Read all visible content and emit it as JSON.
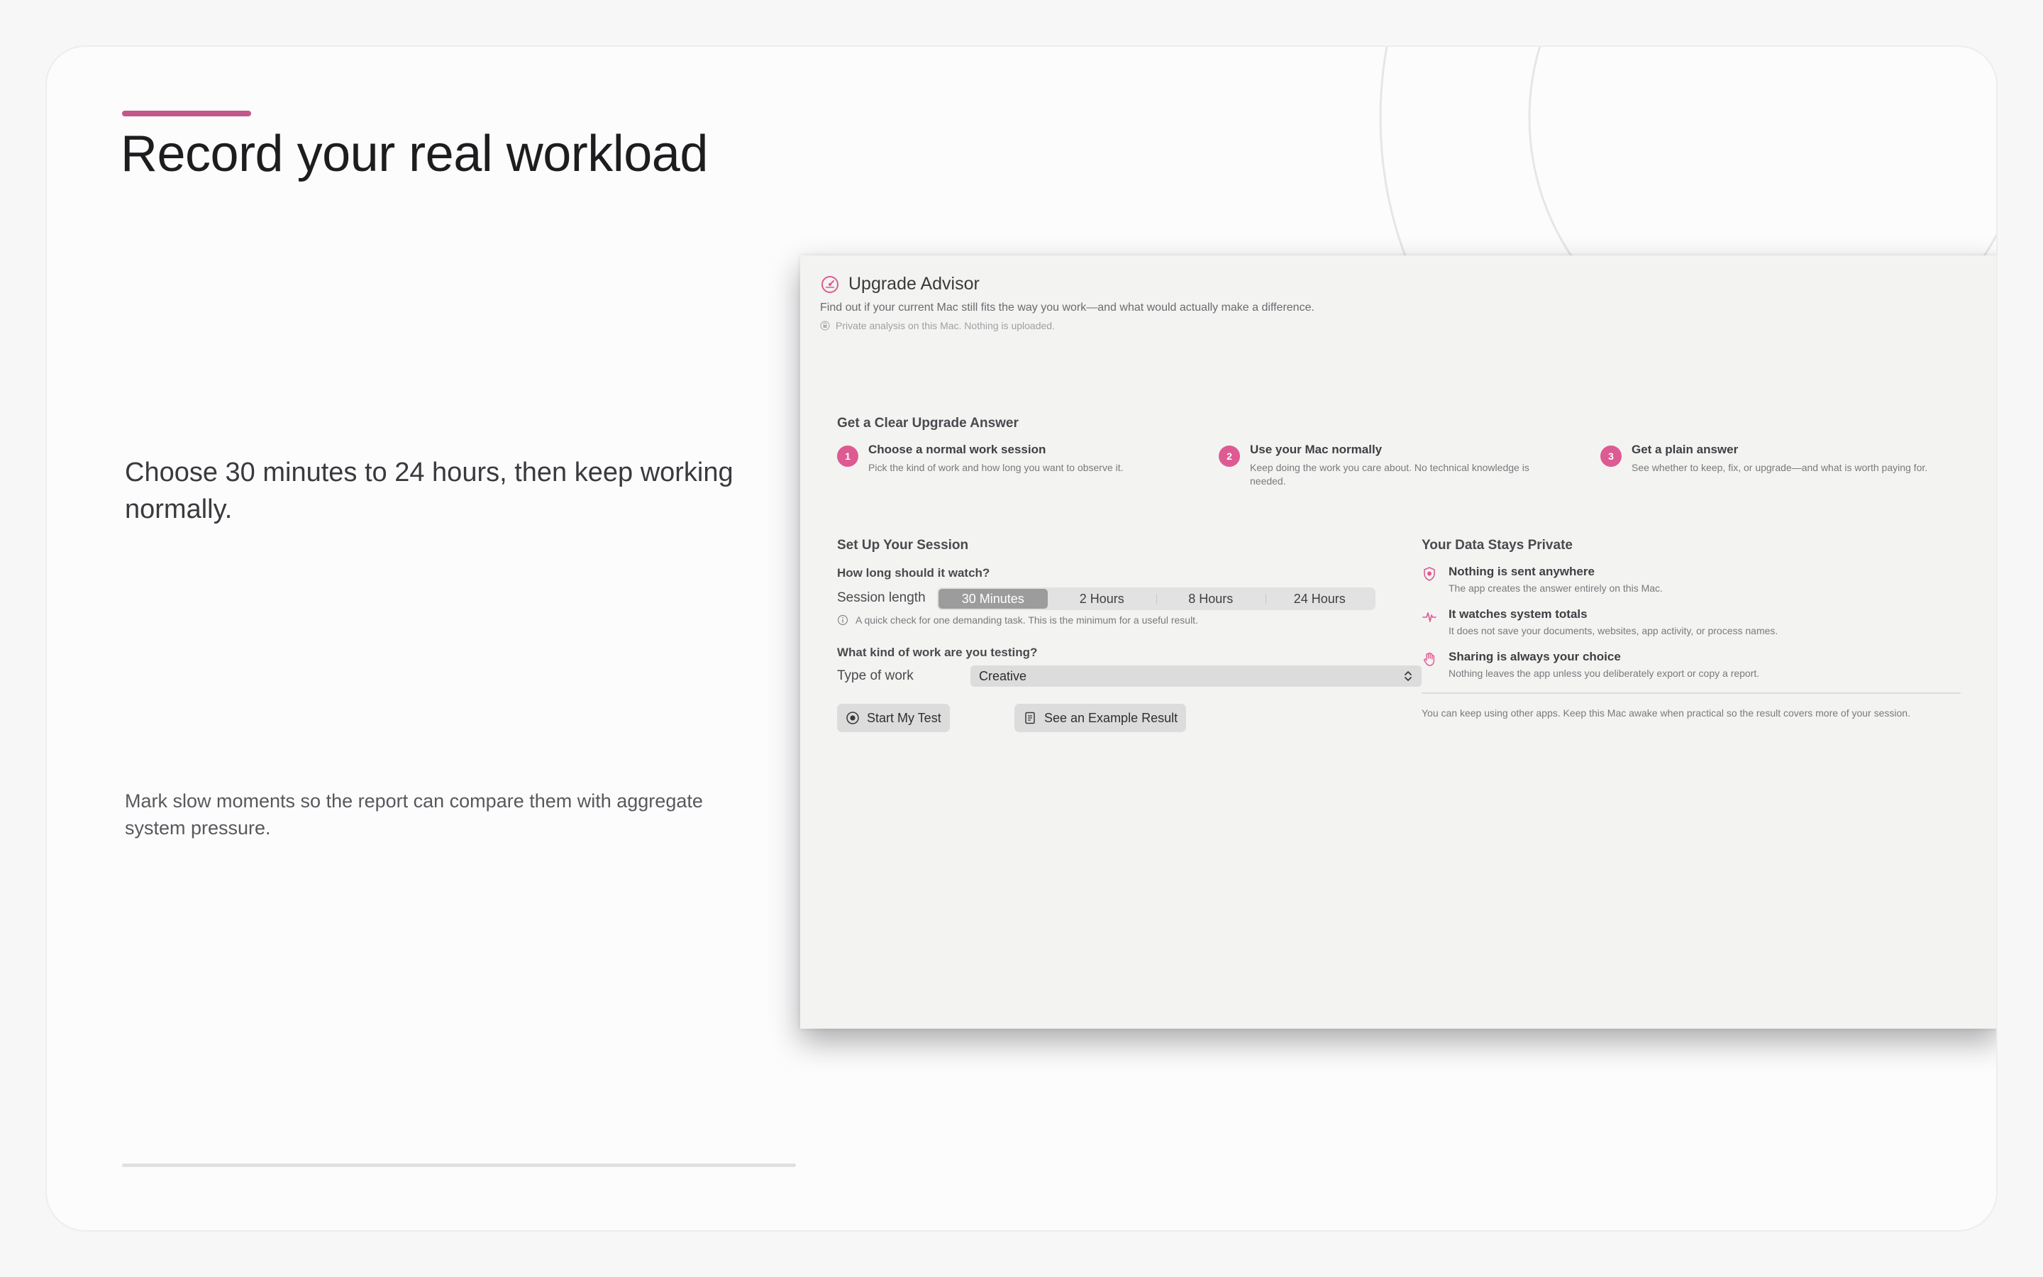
{
  "slide": {
    "title": "Record your real workload",
    "lead": "Choose 30 minutes to 24 hours, then keep working normally.",
    "sub": "Mark slow moments so the report can compare them with aggregate system pressure."
  },
  "app": {
    "title": "Upgrade Advisor",
    "description": "Find out if your current Mac still fits the way you work—and what would actually make a difference.",
    "privacy_note": "Private analysis on this Mac. Nothing is uploaded.",
    "accent_color": "#dd5a92",
    "steps_section": {
      "title": "Get a Clear Upgrade Answer",
      "steps": [
        {
          "number": "1",
          "title": "Choose a normal work session",
          "description": "Pick the kind of work and how long you want to observe it."
        },
        {
          "number": "2",
          "title": "Use your Mac normally",
          "description": "Keep doing the work you care about. No technical knowledge is needed."
        },
        {
          "number": "3",
          "title": "Get a plain answer",
          "description": "See whether to keep, fix, or upgrade—and what is worth paying for."
        }
      ]
    },
    "session": {
      "title": "Set Up Your Session",
      "duration_question": "How long should it watch?",
      "length_label": "Session length",
      "length_options": [
        "30 Minutes",
        "2 Hours",
        "8 Hours",
        "24 Hours"
      ],
      "selected_length": "30 Minutes",
      "length_hint": "A quick check for one demanding task. This is the minimum for a useful result.",
      "work_question": "What kind of work are you testing?",
      "work_label": "Type of work",
      "work_value": "Creative",
      "start_button": "Start My Test",
      "example_button": "See an Example Result"
    },
    "privacy": {
      "title": "Your Data Stays Private",
      "items": [
        {
          "icon": "shield-icon",
          "title": "Nothing is sent anywhere",
          "description": "The app creates the answer entirely on this Mac."
        },
        {
          "icon": "waveform-icon",
          "title": "It watches system totals",
          "description": "It does not save your documents, websites, app activity, or process names."
        },
        {
          "icon": "hand-icon",
          "title": "Sharing is always your choice",
          "description": "Nothing leaves the app unless you deliberately export or copy a report."
        }
      ],
      "note": "You can keep using other apps. Keep this Mac awake when practical so the result covers more of your session."
    }
  }
}
